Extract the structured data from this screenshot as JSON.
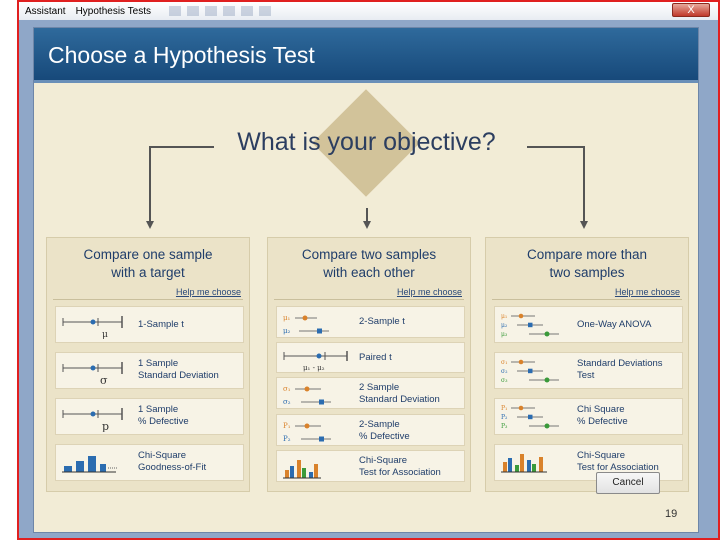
{
  "window": {
    "menu": [
      "Assistant",
      "Hypothesis Tests"
    ],
    "close_label": "X"
  },
  "dialog": {
    "title": "Choose a Hypothesis Test",
    "objective": "What is your objective?",
    "cancel_label": "Cancel",
    "page_number": "19"
  },
  "columns": [
    {
      "heading": [
        "Compare one sample",
        "with a target"
      ],
      "help": "Help me choose",
      "tests": [
        {
          "label": [
            "1-Sample t"
          ],
          "icon": "one-sample-t-icon"
        },
        {
          "label": [
            "1 Sample",
            "Standard Deviation"
          ],
          "icon": "one-sample-stdev-icon"
        },
        {
          "label": [
            "1 Sample",
            "% Defective"
          ],
          "icon": "one-sample-defective-icon"
        },
        {
          "label": [
            "Chi-Square",
            "Goodness-of-Fit"
          ],
          "icon": "goodness-of-fit-icon"
        }
      ]
    },
    {
      "heading": [
        "Compare two samples",
        "with each other"
      ],
      "help": "Help me choose",
      "tests": [
        {
          "label": [
            "2-Sample t"
          ],
          "icon": "two-sample-t-icon"
        },
        {
          "label": [
            "Paired t"
          ],
          "icon": "paired-t-icon"
        },
        {
          "label": [
            "2 Sample",
            "Standard Deviation"
          ],
          "icon": "two-sample-stdev-icon"
        },
        {
          "label": [
            "2-Sample",
            "% Defective"
          ],
          "icon": "two-sample-defective-icon"
        },
        {
          "label": [
            "Chi-Square",
            "Test for Association"
          ],
          "icon": "association-icon"
        }
      ]
    },
    {
      "heading": [
        "Compare more than",
        "two samples"
      ],
      "help": "Help me choose",
      "tests": [
        {
          "label": [
            "One-Way ANOVA"
          ],
          "icon": "anova-icon"
        },
        {
          "label": [
            "Standard Deviations",
            "Test"
          ],
          "icon": "stdev-test-icon"
        },
        {
          "label": [
            "Chi Square",
            "% Defective"
          ],
          "icon": "chi-square-defective-icon"
        },
        {
          "label": [
            "Chi-Square",
            "Test for Association"
          ],
          "icon": "association-icon"
        }
      ]
    }
  ],
  "icon_text": {
    "mu": "μ",
    "sigma": "σ",
    "p": "p",
    "mu1": "μ₁",
    "mu2": "μ₂",
    "mu3": "μ₃",
    "mu_diff": "μ₁ - μ₂",
    "s1": "σ₁",
    "s2": "σ₂",
    "s3": "σ₃",
    "p1": "P₁",
    "p2": "P₂",
    "p3": "P₃"
  },
  "colors": {
    "header": "#1f5688",
    "dialog_bg": "#f2ecd6",
    "diamond": "#d2c39a",
    "text_blue": "#1f3d6a",
    "marker_orange": "#d9822b",
    "marker_blue": "#2b6cb0",
    "marker_green": "#3a9a3a",
    "frame_red": "#e02020"
  }
}
